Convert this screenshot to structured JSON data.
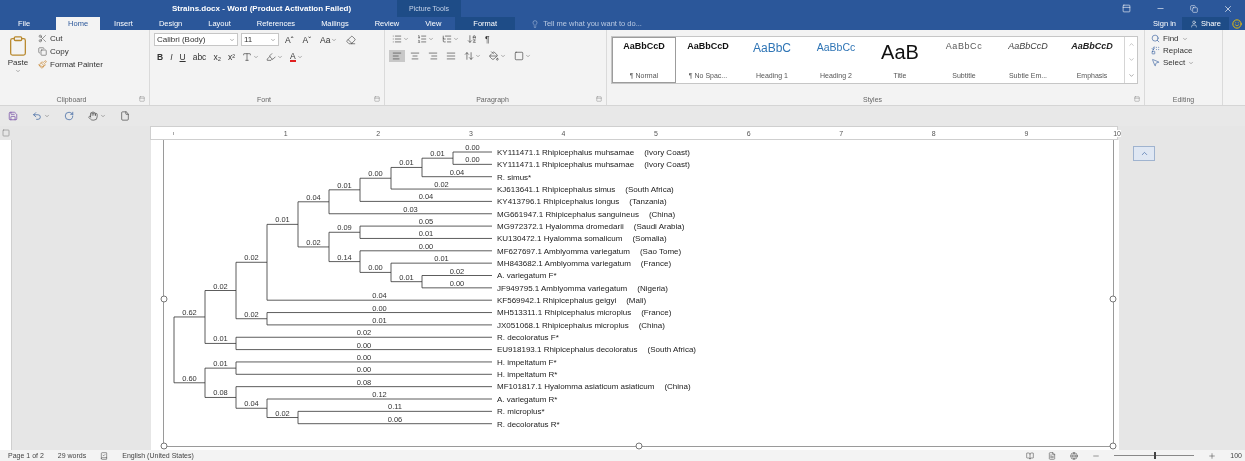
{
  "window": {
    "title": "Strains.docx - Word (Product Activation Failed)",
    "context_title": "Picture Tools"
  },
  "tabs": [
    {
      "label": "File",
      "kind": "file",
      "selected": false
    },
    {
      "label": "Home",
      "kind": "normal",
      "selected": true
    },
    {
      "label": "Insert",
      "kind": "normal",
      "selected": false
    },
    {
      "label": "Design",
      "kind": "normal",
      "selected": false
    },
    {
      "label": "Layout",
      "kind": "normal",
      "selected": false
    },
    {
      "label": "References",
      "kind": "normal",
      "selected": false
    },
    {
      "label": "Mailings",
      "kind": "normal",
      "selected": false
    },
    {
      "label": "Review",
      "kind": "normal",
      "selected": false
    },
    {
      "label": "View",
      "kind": "normal",
      "selected": false
    },
    {
      "label": "Format",
      "kind": "contextual",
      "selected": false
    }
  ],
  "tell_me": {
    "placeholder": "Tell me what you want to do..."
  },
  "account": {
    "sign_in": "Sign in",
    "share": "Share"
  },
  "clipboard": {
    "label": "Clipboard",
    "paste": "Paste",
    "items": [
      "Cut",
      "Copy",
      "Format Painter"
    ]
  },
  "font": {
    "label": "Font",
    "name": "Calibri (Body)",
    "size": "11",
    "grow": "Aˆ",
    "shrink": "Aˇ",
    "change_case": "Aa",
    "format_buttons": [
      "B",
      "I",
      "U",
      "abc",
      "x₂",
      "x²"
    ],
    "font_color": "A"
  },
  "paragraph": {
    "label": "Paragraph",
    "show_marks": "¶"
  },
  "styles": {
    "label": "Styles",
    "items": [
      {
        "preview": "AaBbCcD",
        "name": "¶ Normal",
        "kind": "normal",
        "selected": true
      },
      {
        "preview": "AaBbCcD",
        "name": "¶ No Spac...",
        "kind": "normal",
        "selected": false
      },
      {
        "preview": "AaBbC",
        "name": "Heading 1",
        "kind": "heading1",
        "selected": false
      },
      {
        "preview": "AaBbCc",
        "name": "Heading 2",
        "kind": "heading2",
        "selected": false
      },
      {
        "preview": "AaB",
        "name": "Title",
        "kind": "title",
        "selected": false
      },
      {
        "preview": "AaBbCc",
        "name": "Subtitle",
        "kind": "subtitle",
        "selected": false
      },
      {
        "preview": "AaBbCcD",
        "name": "Subtle Em...",
        "kind": "subtle",
        "selected": false
      },
      {
        "preview": "AaBbCcD",
        "name": "Emphasis",
        "kind": "emphasis",
        "selected": false
      }
    ]
  },
  "editing": {
    "label": "Editing",
    "items": [
      "Find",
      "Replace",
      "Select"
    ]
  },
  "ruler": {
    "numbers": [
      "1",
      "2",
      "3",
      "4",
      "5",
      "6",
      "7",
      "8",
      "9",
      "10"
    ]
  },
  "tree": {
    "children": [
      {
        "branch": "0.62",
        "children": [
          {
            "branch": "0.02",
            "children": [
              {
                "branch": "0.02",
                "children": [
                  {
                    "branch": "0.01",
                    "children": [
                      {
                        "branch": "0.04",
                        "children": [
                          {
                            "branch": "0.01",
                            "children": [
                              {
                                "branch": "0.00",
                                "children": [
                                  {
                                    "branch": "0.01",
                                    "children": [
                                      {
                                        "branch": "0.01",
                                        "children": [
                                          {
                                            "label": "KY111471.1 Rhipicephalus muhsamae",
                                            "country": "(Ivory Coast)",
                                            "branch": "0.00"
                                          },
                                          {
                                            "label": "KY111471.1 Rhipicephalus muhsamae",
                                            "country": "(Ivory Coast)",
                                            "branch": "0.00"
                                          }
                                        ]
                                      },
                                      {
                                        "label": "R. simus*",
                                        "branch": "0.04"
                                      }
                                    ]
                                  },
                                  {
                                    "label": "KJ613641.1 Rhipicephalus simus",
                                    "country": "(South Africa)",
                                    "branch": "0.02"
                                  }
                                ]
                              },
                              {
                                "label": "KY413796.1 Rhipicephalus longus",
                                "country": "(Tanzania)",
                                "branch": "0.04"
                              }
                            ]
                          },
                          {
                            "label": "MG661947.1 Rhipicephalus sanguineus",
                            "country": "(China)",
                            "branch": "0.03"
                          }
                        ]
                      },
                      {
                        "branch": "0.02",
                        "children": [
                          {
                            "branch": "0.09",
                            "children": [
                              {
                                "label": "MG972372.1 Hyalomma dromedarii",
                                "country": "(Saudi Arabia)",
                                "branch": "0.05"
                              },
                              {
                                "label": "KU130472.1 Hyalomma somalicum",
                                "country": "(Somalia)",
                                "branch": "0.01"
                              }
                            ]
                          },
                          {
                            "branch": "0.14",
                            "children": [
                              {
                                "label": "MF627697.1 Amblyomma variegatum",
                                "country": "(Sao Tome)",
                                "branch": "0.00"
                              },
                              {
                                "branch": "0.00",
                                "children": [
                                  {
                                    "label": "MH843682.1 Amblyomma variegatum",
                                    "country": "(France)",
                                    "branch": "0.01"
                                  },
                                  {
                                    "branch": "0.01",
                                    "children": [
                                      {
                                        "label": "A. variegatum F*",
                                        "branch": "0.02"
                                      },
                                      {
                                        "label": "JF949795.1 Amblyomma variegatum",
                                        "country": "(Nigeria)",
                                        "branch": "0.00"
                                      }
                                    ]
                                  }
                                ]
                              }
                            ]
                          }
                        ]
                      }
                    ]
                  },
                  {
                    "label": "KF569942.1 Rhipicephalus geigyi",
                    "country": "(Mali)",
                    "branch": "0.04"
                  }
                ]
              },
              {
                "branch": "0.02",
                "children": [
                  {
                    "label": "MH513311.1 Rhipicephalus microplus",
                    "country": "(France)",
                    "branch": "0.00"
                  },
                  {
                    "label": "JX051068.1 Rhipicephalus microplus",
                    "country": "(China)",
                    "branch": "0.01"
                  }
                ]
              }
            ]
          },
          {
            "branch": "0.01",
            "children": [
              {
                "label": "R. decoloratus F*",
                "branch": "0.02"
              },
              {
                "label": "EU918193.1 Rhipicephalus decoloratus",
                "country": "(South Africa)",
                "branch": "0.00"
              }
            ]
          }
        ]
      },
      {
        "branch": "0.60",
        "children": [
          {
            "branch": "0.01",
            "children": [
              {
                "label": "H. impeltatum F*",
                "branch": "0.00"
              },
              {
                "label": "H. impeltatum R*",
                "branch": "0.00"
              }
            ]
          },
          {
            "branch": "0.08",
            "children": [
              {
                "label": "MF101817.1 Hyalomma asiaticum asiaticum",
                "country": "(China)",
                "branch": "0.08"
              },
              {
                "branch": "0.04",
                "children": [
                  {
                    "label": "A. variegatum R*",
                    "branch": "0.12"
                  },
                  {
                    "branch": "0.02",
                    "children": [
                      {
                        "label": "R. microplus*",
                        "branch": "0.11"
                      },
                      {
                        "label": "R. decoloratus R*",
                        "branch": "0.06"
                      }
                    ]
                  }
                ]
              }
            ]
          }
        ]
      }
    ]
  },
  "status_bar": {
    "page": "Page 1 of 2",
    "words": "29 words",
    "language": "English (United States)",
    "zoom": "100",
    "zoom_slider": {
      "level": 0.5
    }
  }
}
